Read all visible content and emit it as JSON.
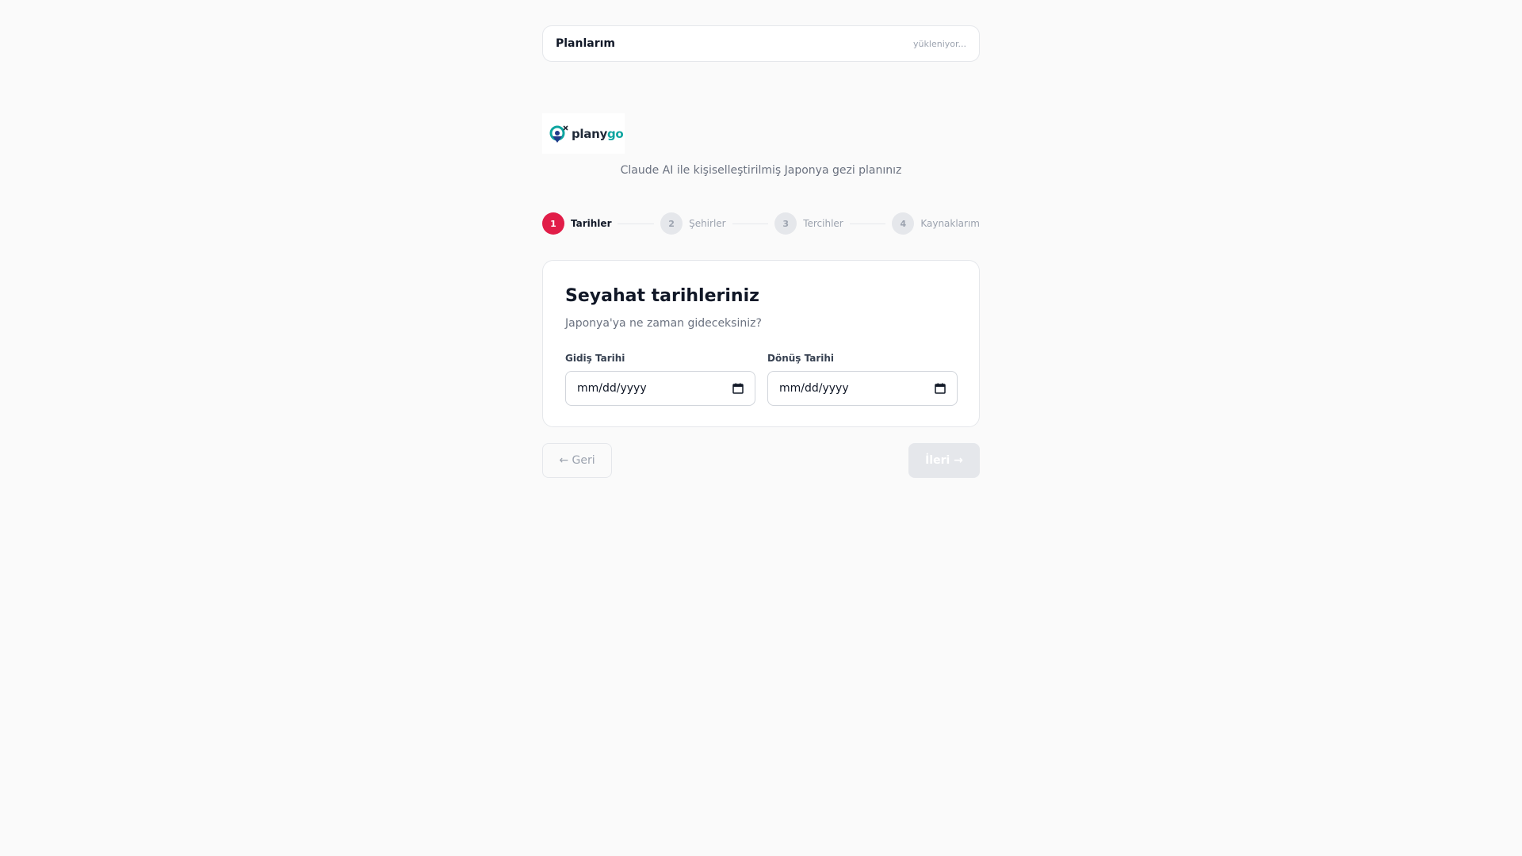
{
  "plans": {
    "title": "Planlarım",
    "status": "yükleniyor..."
  },
  "logo": {
    "text_a": "plany",
    "text_b": "go",
    "icon": "map-pin-plane-icon"
  },
  "subtitle": "Claude AI ile kişiselleştirilmiş Japonya gezi planınız",
  "steps": [
    {
      "num": "1",
      "label": "Tarihler",
      "active": true
    },
    {
      "num": "2",
      "label": "Şehirler",
      "active": false
    },
    {
      "num": "3",
      "label": "Tercihler",
      "active": false
    },
    {
      "num": "4",
      "label": "Kaynaklarım",
      "active": false
    }
  ],
  "card": {
    "title": "Seyahat tarihleriniz",
    "subtitle": "Japonya'ya ne zaman gideceksiniz?",
    "departure": {
      "label": "Gidiş Tarihi",
      "value": "mm/dd/yyyy"
    },
    "return": {
      "label": "Dönüş Tarihi",
      "value": "mm/dd/yyyy"
    }
  },
  "buttons": {
    "back": "← Geri",
    "next": "İleri →"
  },
  "colors": {
    "accent": "#e11d48",
    "brand_teal": "#0ea5a0",
    "background": "#fafafa"
  }
}
